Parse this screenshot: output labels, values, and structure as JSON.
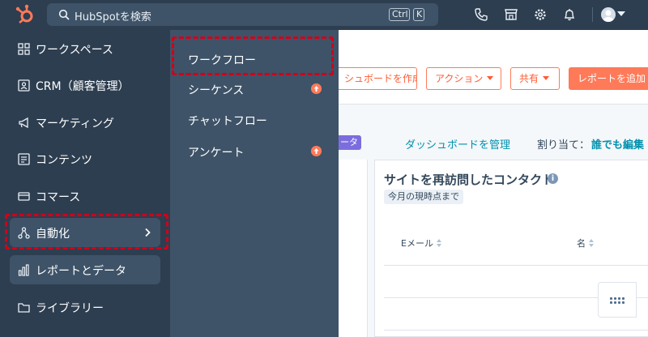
{
  "topbar": {
    "search_placeholder": "HubSpotを検索",
    "shortcut_ctrl": "Ctrl",
    "shortcut_k": "K"
  },
  "sidebar": {
    "items": [
      {
        "label": "ワークスペース",
        "icon": "grid-icon"
      },
      {
        "label": "CRM（顧客管理）",
        "icon": "crm-icon"
      },
      {
        "label": "マーケティング",
        "icon": "megaphone-icon"
      },
      {
        "label": "コンテンツ",
        "icon": "content-icon"
      },
      {
        "label": "コマース",
        "icon": "commerce-icon"
      },
      {
        "label": "自動化",
        "icon": "automation-icon"
      },
      {
        "label": "レポートとデータ",
        "icon": "reports-icon"
      },
      {
        "label": "ライブラリー",
        "icon": "folder-icon"
      }
    ]
  },
  "flyout": {
    "items": [
      {
        "label": "ワークフロー",
        "upgrade": false
      },
      {
        "label": "シーケンス",
        "upgrade": true
      },
      {
        "label": "チャットフロー",
        "upgrade": false
      },
      {
        "label": "アンケート",
        "upgrade": true
      }
    ]
  },
  "header": {
    "create_dashboard": "シュボードを作成",
    "actions": "アクション",
    "share": "共有",
    "add_report": "レポートを追加"
  },
  "subbar": {
    "tag": "ータ",
    "manage_dashboard": "ダッシュボードを管理",
    "assign_label": "割り当て：",
    "assign_value": "誰でも編集"
  },
  "card": {
    "title": "サイトを再訪問したコンタクト",
    "period_badge": "今月の現時点まで",
    "columns": [
      "Eメール",
      "名"
    ]
  },
  "colors": {
    "nav_bg": "#2d3e50",
    "flyout_bg": "#3e5368",
    "accent": "#ff7a59",
    "link": "#0091ae",
    "highlight": "#d0021b"
  }
}
